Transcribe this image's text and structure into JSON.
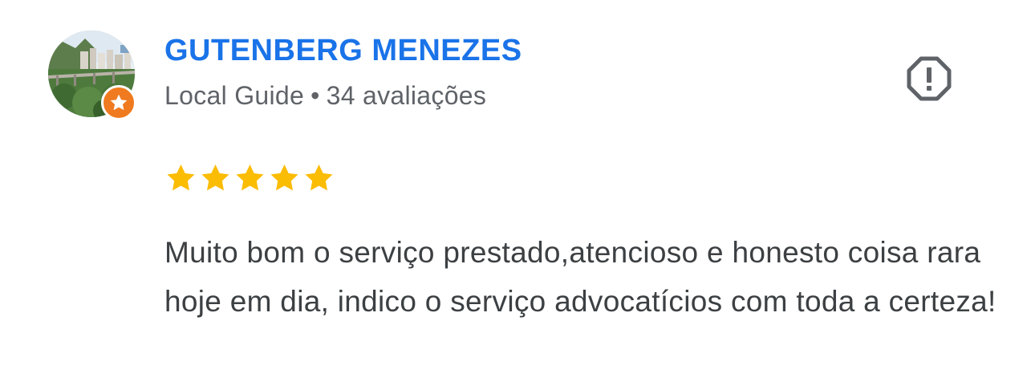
{
  "review": {
    "author": {
      "name": "GUTENBERG MENEZES",
      "badge": "Local Guide",
      "separator": "•",
      "review_count": "34 avaliações"
    },
    "rating": 5,
    "rating_max": 5,
    "text": "Muito bom o serviço prestado,atencioso e honesto coisa rara hoje em dia, indico o serviço advocatícios com toda a certeza!"
  },
  "icons": {
    "avatar": "profile-photo",
    "badge": "local-guide-star-icon",
    "report": "report-flag-icon",
    "star": "star-icon"
  },
  "colors": {
    "name": "#1a73e8",
    "meta": "#5f6368",
    "text": "#3c4043",
    "star": "#fbbc04",
    "badge": "#ef7a1f",
    "report_icon": "#5f6368"
  }
}
